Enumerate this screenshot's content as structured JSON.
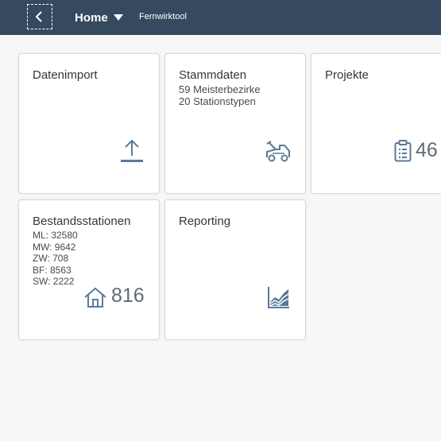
{
  "header": {
    "home_label": "Home",
    "app_name": "Fernwirktool"
  },
  "tiles": [
    {
      "title": "Datenimport",
      "subtitle": [],
      "icon": "upload-icon",
      "number": ""
    },
    {
      "title": "Stammdaten",
      "subtitle": [
        "59 Meisterbezirke",
        "20 Stationstypen"
      ],
      "icon": "truck-icon",
      "number": ""
    },
    {
      "title": "Projekte",
      "subtitle": [],
      "icon": "clipboard-icon",
      "number": "46"
    },
    {
      "title": "Bestandsstationen",
      "subtitle": [
        "ML: 32580",
        "MW: 9642",
        "ZW: 708",
        "BF: 8563",
        "SW: 2222"
      ],
      "icon": "home-icon",
      "number": "816"
    },
    {
      "title": "Reporting",
      "subtitle": [],
      "icon": "area-chart-icon",
      "number": ""
    }
  ],
  "colors": {
    "shell_bar": "#354a5f",
    "background": "#f7f7f7",
    "icon": "#5b7a99"
  }
}
